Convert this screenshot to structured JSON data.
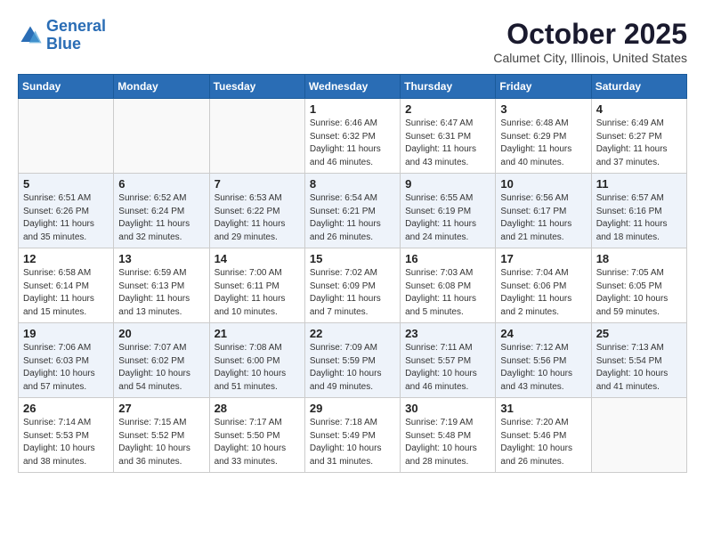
{
  "header": {
    "logo_line1": "General",
    "logo_line2": "Blue",
    "month": "October 2025",
    "location": "Calumet City, Illinois, United States"
  },
  "weekdays": [
    "Sunday",
    "Monday",
    "Tuesday",
    "Wednesday",
    "Thursday",
    "Friday",
    "Saturday"
  ],
  "weeks": [
    [
      {
        "day": "",
        "info": ""
      },
      {
        "day": "",
        "info": ""
      },
      {
        "day": "",
        "info": ""
      },
      {
        "day": "1",
        "info": "Sunrise: 6:46 AM\nSunset: 6:32 PM\nDaylight: 11 hours\nand 46 minutes."
      },
      {
        "day": "2",
        "info": "Sunrise: 6:47 AM\nSunset: 6:31 PM\nDaylight: 11 hours\nand 43 minutes."
      },
      {
        "day": "3",
        "info": "Sunrise: 6:48 AM\nSunset: 6:29 PM\nDaylight: 11 hours\nand 40 minutes."
      },
      {
        "day": "4",
        "info": "Sunrise: 6:49 AM\nSunset: 6:27 PM\nDaylight: 11 hours\nand 37 minutes."
      }
    ],
    [
      {
        "day": "5",
        "info": "Sunrise: 6:51 AM\nSunset: 6:26 PM\nDaylight: 11 hours\nand 35 minutes."
      },
      {
        "day": "6",
        "info": "Sunrise: 6:52 AM\nSunset: 6:24 PM\nDaylight: 11 hours\nand 32 minutes."
      },
      {
        "day": "7",
        "info": "Sunrise: 6:53 AM\nSunset: 6:22 PM\nDaylight: 11 hours\nand 29 minutes."
      },
      {
        "day": "8",
        "info": "Sunrise: 6:54 AM\nSunset: 6:21 PM\nDaylight: 11 hours\nand 26 minutes."
      },
      {
        "day": "9",
        "info": "Sunrise: 6:55 AM\nSunset: 6:19 PM\nDaylight: 11 hours\nand 24 minutes."
      },
      {
        "day": "10",
        "info": "Sunrise: 6:56 AM\nSunset: 6:17 PM\nDaylight: 11 hours\nand 21 minutes."
      },
      {
        "day": "11",
        "info": "Sunrise: 6:57 AM\nSunset: 6:16 PM\nDaylight: 11 hours\nand 18 minutes."
      }
    ],
    [
      {
        "day": "12",
        "info": "Sunrise: 6:58 AM\nSunset: 6:14 PM\nDaylight: 11 hours\nand 15 minutes."
      },
      {
        "day": "13",
        "info": "Sunrise: 6:59 AM\nSunset: 6:13 PM\nDaylight: 11 hours\nand 13 minutes."
      },
      {
        "day": "14",
        "info": "Sunrise: 7:00 AM\nSunset: 6:11 PM\nDaylight: 11 hours\nand 10 minutes."
      },
      {
        "day": "15",
        "info": "Sunrise: 7:02 AM\nSunset: 6:09 PM\nDaylight: 11 hours\nand 7 minutes."
      },
      {
        "day": "16",
        "info": "Sunrise: 7:03 AM\nSunset: 6:08 PM\nDaylight: 11 hours\nand 5 minutes."
      },
      {
        "day": "17",
        "info": "Sunrise: 7:04 AM\nSunset: 6:06 PM\nDaylight: 11 hours\nand 2 minutes."
      },
      {
        "day": "18",
        "info": "Sunrise: 7:05 AM\nSunset: 6:05 PM\nDaylight: 10 hours\nand 59 minutes."
      }
    ],
    [
      {
        "day": "19",
        "info": "Sunrise: 7:06 AM\nSunset: 6:03 PM\nDaylight: 10 hours\nand 57 minutes."
      },
      {
        "day": "20",
        "info": "Sunrise: 7:07 AM\nSunset: 6:02 PM\nDaylight: 10 hours\nand 54 minutes."
      },
      {
        "day": "21",
        "info": "Sunrise: 7:08 AM\nSunset: 6:00 PM\nDaylight: 10 hours\nand 51 minutes."
      },
      {
        "day": "22",
        "info": "Sunrise: 7:09 AM\nSunset: 5:59 PM\nDaylight: 10 hours\nand 49 minutes."
      },
      {
        "day": "23",
        "info": "Sunrise: 7:11 AM\nSunset: 5:57 PM\nDaylight: 10 hours\nand 46 minutes."
      },
      {
        "day": "24",
        "info": "Sunrise: 7:12 AM\nSunset: 5:56 PM\nDaylight: 10 hours\nand 43 minutes."
      },
      {
        "day": "25",
        "info": "Sunrise: 7:13 AM\nSunset: 5:54 PM\nDaylight: 10 hours\nand 41 minutes."
      }
    ],
    [
      {
        "day": "26",
        "info": "Sunrise: 7:14 AM\nSunset: 5:53 PM\nDaylight: 10 hours\nand 38 minutes."
      },
      {
        "day": "27",
        "info": "Sunrise: 7:15 AM\nSunset: 5:52 PM\nDaylight: 10 hours\nand 36 minutes."
      },
      {
        "day": "28",
        "info": "Sunrise: 7:17 AM\nSunset: 5:50 PM\nDaylight: 10 hours\nand 33 minutes."
      },
      {
        "day": "29",
        "info": "Sunrise: 7:18 AM\nSunset: 5:49 PM\nDaylight: 10 hours\nand 31 minutes."
      },
      {
        "day": "30",
        "info": "Sunrise: 7:19 AM\nSunset: 5:48 PM\nDaylight: 10 hours\nand 28 minutes."
      },
      {
        "day": "31",
        "info": "Sunrise: 7:20 AM\nSunset: 5:46 PM\nDaylight: 10 hours\nand 26 minutes."
      },
      {
        "day": "",
        "info": ""
      }
    ]
  ]
}
